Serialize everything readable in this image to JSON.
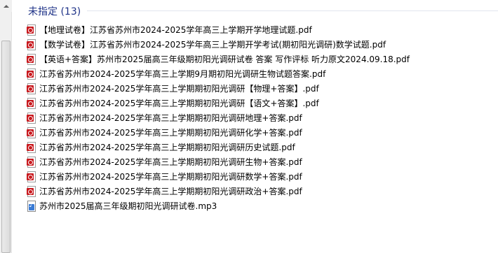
{
  "group": {
    "title": "未指定 (13)"
  },
  "files": [
    {
      "name": "【地理试卷】江苏省苏州市2024-2025学年高三上学期开学地理试题.pdf",
      "icon": "pdf-icon"
    },
    {
      "name": "【数学试卷】江苏省苏州市2024-2025学年高三上学期开学考试(期初阳光调研)数学试题.pdf",
      "icon": "pdf-icon"
    },
    {
      "name": "【英语+答案】苏州市2025届高三年级期初阳光调研试卷 答案 写作评标 听力原文2024.09.18.pdf",
      "icon": "pdf-icon"
    },
    {
      "name": "江苏省苏州市2024-2025学年高三上学期9月期初阳光调研生物试题答案.pdf",
      "icon": "pdf-icon"
    },
    {
      "name": "江苏省苏州市2024-2025学年高三上学期期初阳光调研【物理+答案】.pdf",
      "icon": "pdf-icon"
    },
    {
      "name": "江苏省苏州市2024-2025学年高三上学期期初阳光调研【语文+答案】.pdf",
      "icon": "pdf-icon"
    },
    {
      "name": "江苏省苏州市2024-2025学年高三上学期期初阳光调研地理+答案.pdf",
      "icon": "pdf-icon"
    },
    {
      "name": "江苏省苏州市2024-2025学年高三上学期期初阳光调研化学+答案.pdf",
      "icon": "pdf-icon"
    },
    {
      "name": "江苏省苏州市2024-2025学年高三上学期期初阳光调研历史试题.pdf",
      "icon": "pdf-icon"
    },
    {
      "name": "江苏省苏州市2024-2025学年高三上学期期初阳光调研生物+答案.pdf",
      "icon": "pdf-icon"
    },
    {
      "name": "江苏省苏州市2024-2025学年高三上学期期初阳光调研数学+答案.pdf",
      "icon": "pdf-icon"
    },
    {
      "name": "江苏省苏州市2024-2025学年高三上学期期初阳光调研政治+答案.pdf",
      "icon": "pdf-icon"
    },
    {
      "name": "苏州市2025届高三年级期初阳光调研试卷.mp3",
      "icon": "mp3-icon"
    }
  ],
  "colors": {
    "group_title": "#1e3287",
    "pdf_badge": "#c8191e"
  }
}
